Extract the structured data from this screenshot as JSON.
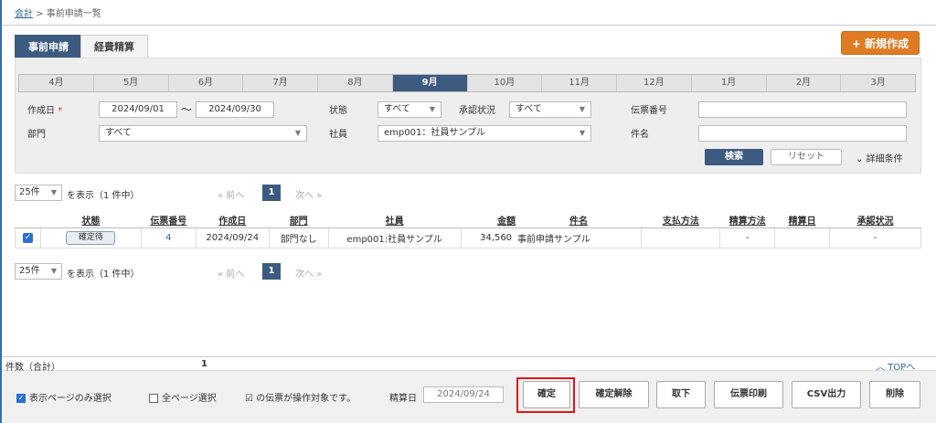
{
  "breadcrumb": {
    "root": "会計",
    "sep": ">",
    "current": "事前申請一覧"
  },
  "tabs": [
    {
      "label": "事前申請",
      "active": true
    },
    {
      "label": "経費精算",
      "active": false
    }
  ],
  "new_button": "+ 新規作成",
  "months": [
    "4月",
    "5月",
    "6月",
    "7月",
    "8月",
    "9月",
    "10月",
    "11月",
    "12月",
    "1月",
    "2月",
    "3月"
  ],
  "selected_month": "9月",
  "search": {
    "created_label": "作成日",
    "required_mark": "*",
    "date_from": "2024/09/01",
    "tilde": "〜",
    "date_to": "2024/09/30",
    "status_label": "状態",
    "status_value": "すべて",
    "approval_label": "承認状況",
    "approval_value": "すべて",
    "voucher_label": "伝票番号",
    "voucher_value": "",
    "dept_label": "部門",
    "dept_value": "すべて",
    "employee_label": "社員",
    "employee_value": "emp001：社員サンプル",
    "subject_label": "件名",
    "subject_value": "",
    "search_button": "検索",
    "reset_button": "リセット",
    "detail_toggle": "詳細条件"
  },
  "pager": {
    "size": "25件",
    "display_text": "を表示（1 件中）",
    "prev": "« 前へ",
    "current": "1",
    "next": "次へ »"
  },
  "table": {
    "headers": [
      "状態",
      "伝票番号",
      "作成日",
      "部門",
      "社員",
      "金額",
      "件名",
      "支払方法",
      "精算方法",
      "精算日",
      "承認状況"
    ],
    "rows": [
      {
        "status": "確定待",
        "voucher": "4",
        "created": "2024/09/24",
        "dept": "部門なし",
        "employee": "emp001:社員サンプル",
        "amount": "34,560",
        "subject": "事前申請サンプル",
        "payment": "",
        "settle_method": "-",
        "settle_date": "",
        "approval": "-"
      }
    ]
  },
  "summary": {
    "label": "件数（合計）",
    "value": "1",
    "top_link": "TOPへ"
  },
  "footer": {
    "page_only": "表示ページのみ選択",
    "all_pages": "全ページ選択",
    "target_text": "の伝票が操作対象です。",
    "settle_date_label": "精算日",
    "settle_date_value": "2024/09/24",
    "buttons": [
      "確定",
      "確定解除",
      "取下",
      "伝票印刷",
      "CSV出力",
      "削除"
    ]
  },
  "colors": {
    "primary": "#3d5a80",
    "accent": "#e07b23",
    "highlight": "#e0141a"
  }
}
